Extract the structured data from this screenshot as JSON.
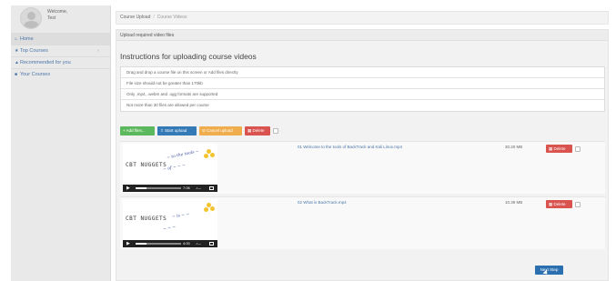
{
  "user": {
    "welcome": "Welcome,",
    "name": "Test"
  },
  "sidebar": {
    "items": [
      {
        "label": "Home",
        "icon": "home-icon"
      },
      {
        "label": "Top Courses",
        "icon": "star-icon"
      },
      {
        "label": "Recommended for you",
        "icon": "thumbs-up-icon"
      },
      {
        "label": "Your Courses",
        "icon": "folder-icon"
      }
    ]
  },
  "breadcrumb": {
    "root": "Course Upload",
    "current": "Course Videos"
  },
  "panel": {
    "heading": "Upload required video files",
    "title": "Instructions for uploading course videos"
  },
  "instructions": [
    "Drag and drop a course file on this screen or Add files directly",
    "File size should not be greater than 170kb",
    "Only .mp4, .webm and .ogg formats are supported",
    "Not more than 30 files are allowed per course"
  ],
  "toolbar": {
    "add": "Add files...",
    "start": "Start upload",
    "cancel": "Cancel upload",
    "delete": "Delete"
  },
  "files": [
    {
      "name": "01 Welcome to the tools of BackTrack and Kali Linux.mp4",
      "size": "30.20 MB",
      "delete": "Delete",
      "time": "7:06",
      "thumb_title": "CBT NUGGETS"
    },
    {
      "name": "02 What is BackTrack.mp4",
      "size": "10.39 MB",
      "delete": "Delete",
      "time": "4:00",
      "thumb_title": "CBT NUGGETS"
    }
  ],
  "next_step": "Next Step",
  "colors": {
    "add": "#5cb85c",
    "start": "#337ab7",
    "cancel": "#f0ad4e",
    "delete": "#d9534f",
    "next": "#2a6fb0"
  }
}
